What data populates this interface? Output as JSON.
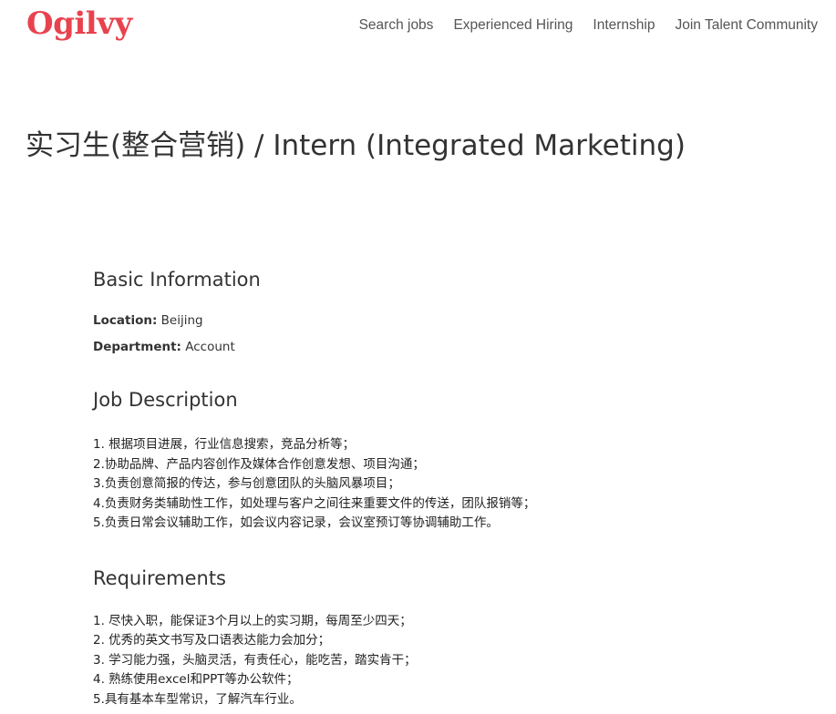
{
  "header": {
    "logo": "Ogilvy",
    "nav": [
      "Search jobs",
      "Experienced Hiring",
      "Internship",
      "Join Talent Community"
    ]
  },
  "job": {
    "title": "实习生(整合营销) / Intern (Integrated Marketing)"
  },
  "basic_info": {
    "heading": "Basic Information",
    "location_label": "Location:",
    "location_value": "Beijing",
    "department_label": "Department:",
    "department_value": "Account"
  },
  "job_description": {
    "heading": "Job Description",
    "items": [
      "1. 根据项目进展，行业信息搜索，竞品分析等；",
      "2.协助品牌、产品内容创作及媒体合作创意发想、项目沟通；",
      "3.负责创意简报的传达，参与创意团队的头脑风暴项目；",
      "4.负责财务类辅助性工作，如处理与客户之间往来重要文件的传送，团队报销等；",
      "5.负责日常会议辅助工作，如会议内容记录，会议室预订等协调辅助工作。"
    ]
  },
  "requirements": {
    "heading": "Requirements",
    "items": [
      "1. 尽快入职，能保证3个月以上的实习期，每周至少四天；",
      "2. 优秀的英文书写及口语表达能力会加分；",
      "3. 学习能力强，头脑灵活，有责任心，能吃苦，踏实肯干；",
      "4. 熟练使用excel和PPT等办公软件；",
      "5.具有基本车型常识，了解汽车行业。"
    ]
  },
  "colors": {
    "brand": "#e8424e",
    "nav_text": "#555555",
    "body_text": "#222222"
  }
}
